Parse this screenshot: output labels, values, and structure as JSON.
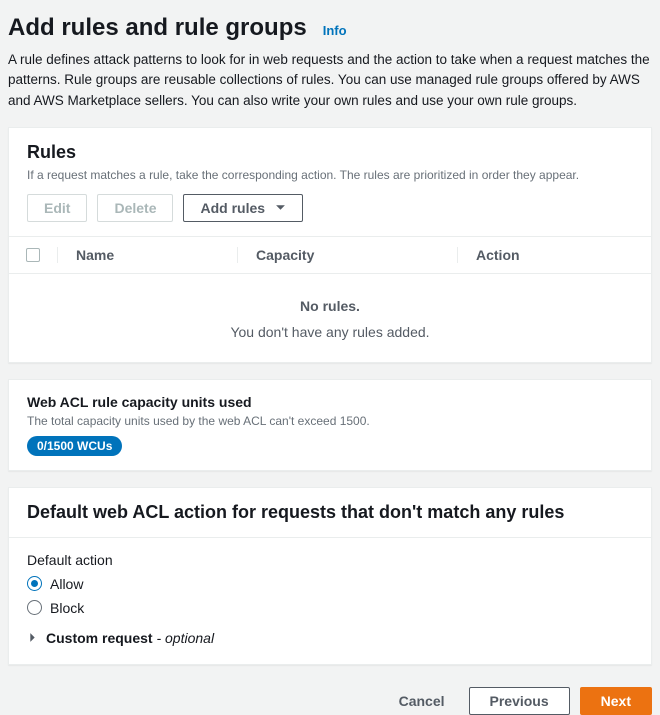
{
  "header": {
    "title": "Add rules and rule groups",
    "info": "Info",
    "description": "A rule defines attack patterns to look for in web requests and the action to take when a request matches the patterns. Rule groups are reusable collections of rules. You can use managed rule groups offered by AWS and AWS Marketplace sellers. You can also write your own rules and use your own rule groups."
  },
  "rulesPanel": {
    "title": "Rules",
    "subtitle": "If a request matches a rule, take the corresponding action. The rules are prioritized in order they appear.",
    "buttons": {
      "edit": "Edit",
      "delete": "Delete",
      "addRules": "Add rules"
    },
    "columns": {
      "name": "Name",
      "capacity": "Capacity",
      "action": "Action"
    },
    "empty": {
      "title": "No rules.",
      "desc": "You don't have any rules added."
    }
  },
  "capacityPanel": {
    "title": "Web ACL rule capacity units used",
    "desc": "The total capacity units used by the web ACL can't exceed 1500.",
    "badge": "0/1500 WCUs"
  },
  "defaultActionPanel": {
    "title": "Default web ACL action for requests that don't match any rules",
    "formLabel": "Default action",
    "options": {
      "allow": "Allow",
      "block": "Block"
    },
    "selected": "allow",
    "expand": {
      "label": "Custom request",
      "optional": " - optional"
    }
  },
  "footer": {
    "cancel": "Cancel",
    "previous": "Previous",
    "next": "Next"
  }
}
